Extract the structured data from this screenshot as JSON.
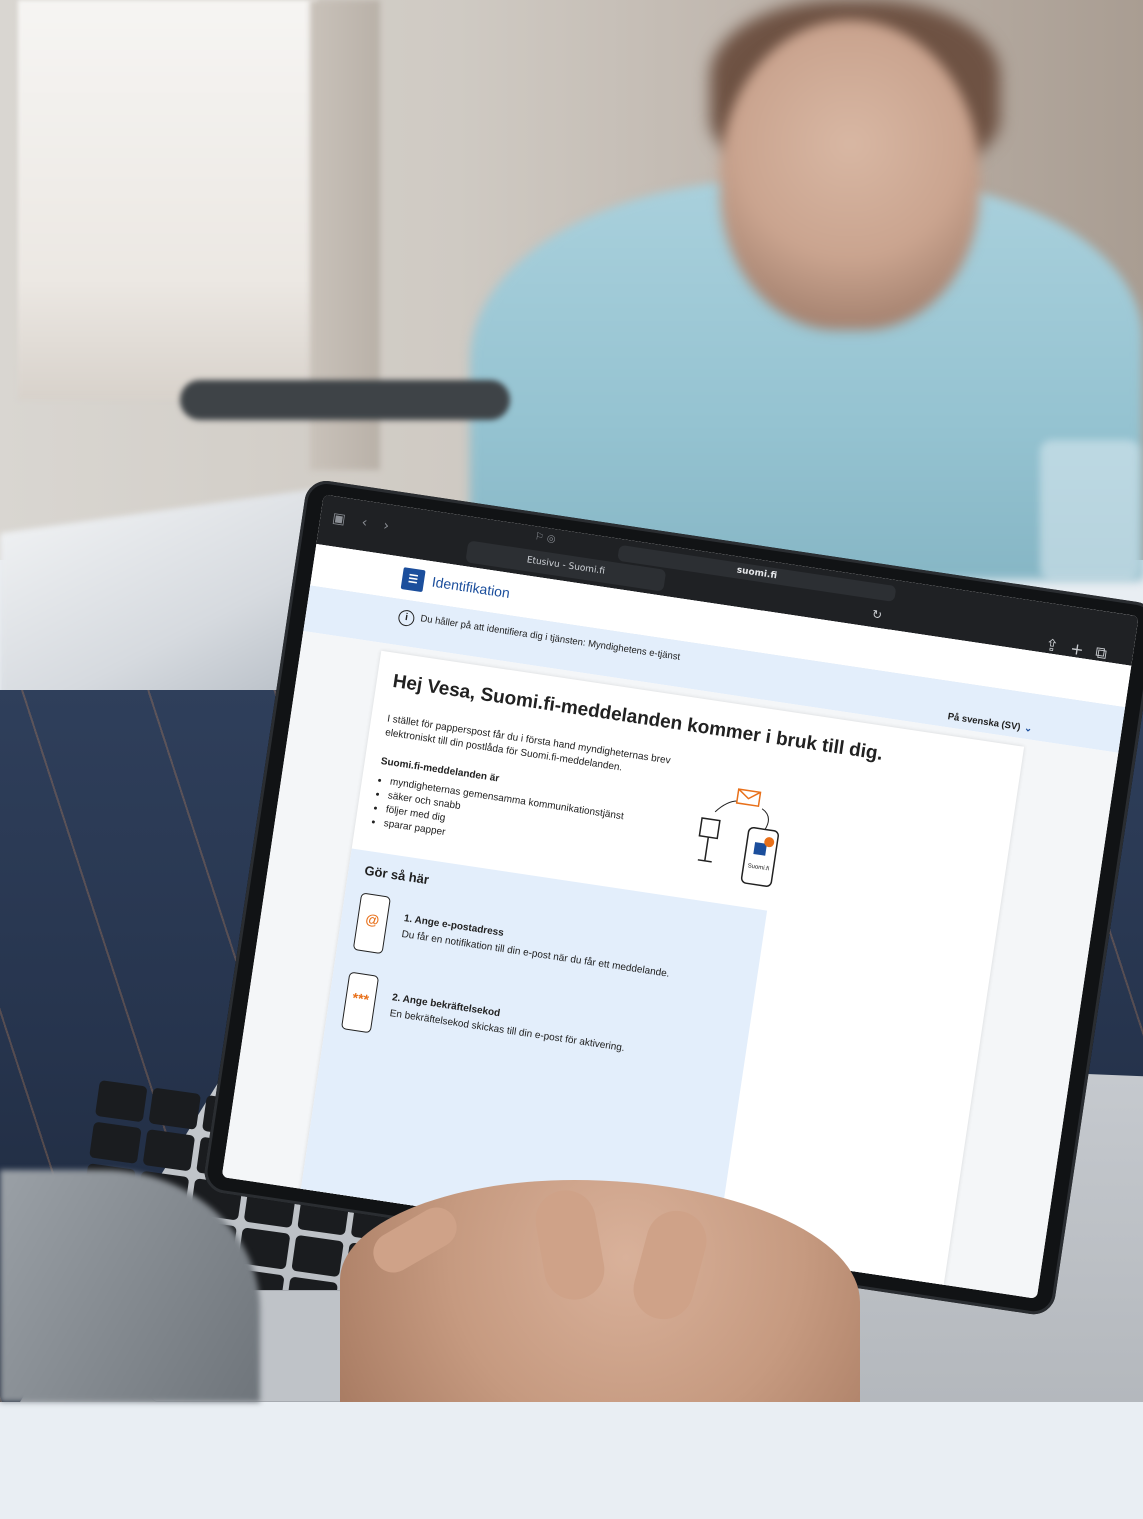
{
  "browser": {
    "tab_title": "Etusivu - Suomi.fi",
    "url": "suomi.fi"
  },
  "header": {
    "logo_text": "Identifikation"
  },
  "notice": {
    "text": "Du håller på att identifiera dig i tjänsten: Myndighetens e-tjänst",
    "language": "På svenska (SV)"
  },
  "main": {
    "heading": "Hej Vesa, Suomi.fi-meddelanden kommer i bruk till dig.",
    "intro": "I stället för papperspost får du i första hand myndigheternas brev elektroniskt till din postlåda för Suomi.fi-meddelanden.",
    "list_title": "Suomi.fi-meddelanden är",
    "list_items": [
      "myndigheternas gemensamma kommunikationstjänst",
      "säker och snabb",
      "följer med dig",
      "sparar papper"
    ],
    "illustration_label": "Suomi.fi"
  },
  "steps": {
    "title": "Gör så här",
    "items": [
      {
        "title": "1. Ange e-postadress",
        "desc": "Du får en notifikation till din e-post när du får ett meddelande."
      },
      {
        "title": "2. Ange bekräftelsekod",
        "desc": "En bekräftelsekod skickas till din e-post för aktivering."
      }
    ]
  },
  "colors": {
    "brand_blue": "#1b4e9c",
    "accent_orange": "#e8701a",
    "notice_bg": "#e3eefb"
  }
}
